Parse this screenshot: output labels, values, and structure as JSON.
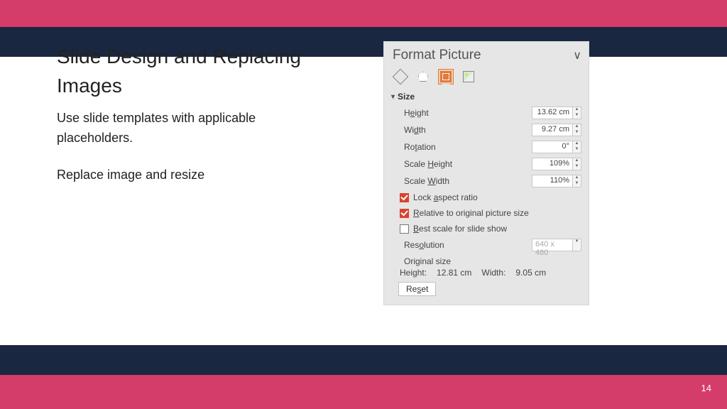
{
  "slide": {
    "title": "Slide Design and Replacing Images",
    "para1": "Use slide templates with applicable placeholders.",
    "para2": "Replace image and resize",
    "page_number": "14"
  },
  "panel": {
    "title": "Format Picture",
    "collapse_glyph": "∨",
    "tabs": {
      "fill": "fill-icon",
      "effects": "effects-icon",
      "size": "size-properties-icon",
      "picture": "picture-icon",
      "active": "size"
    },
    "section": {
      "chevron": "▾",
      "label": "Size",
      "height_label_pre": "H",
      "height_label_u": "e",
      "height_label_post": "ight",
      "width_label_pre": "Wi",
      "width_label_u": "d",
      "width_label_post": "th",
      "rotation_label_pre": "Ro",
      "rotation_label_u": "t",
      "rotation_label_post": "ation",
      "scaleh_label_pre": "Scale ",
      "scaleh_label_u": "H",
      "scaleh_label_post": "eight",
      "scalew_label_pre": "Scale ",
      "scalew_label_u": "W",
      "scalew_label_post": "idth",
      "height_value": "13.62 cm",
      "width_value": "9.27 cm",
      "rotation_value": "0°",
      "scaleh_value": "109%",
      "scalew_value": "110%",
      "lock_label_pre": "Lock ",
      "lock_label_u": "a",
      "lock_label_post": "spect ratio",
      "rel_label_u": "R",
      "rel_label_post": "elative to original picture size",
      "best_label_u": "B",
      "best_label_post": "est scale for slide show",
      "lock_checked": true,
      "relative_checked": true,
      "best_checked": false,
      "resolution_label_pre": "Res",
      "resolution_label_u": "o",
      "resolution_label_post": "lution",
      "resolution_value": "640 x 480",
      "original_label": "Original size",
      "orig_h_label": "Height:",
      "orig_h_value": "12.81 cm",
      "orig_w_label": "Width:",
      "orig_w_value": "9.05 cm",
      "reset_pre": "Re",
      "reset_u": "s",
      "reset_post": "et"
    }
  },
  "spinner": {
    "up": "▲",
    "down": "▼"
  }
}
